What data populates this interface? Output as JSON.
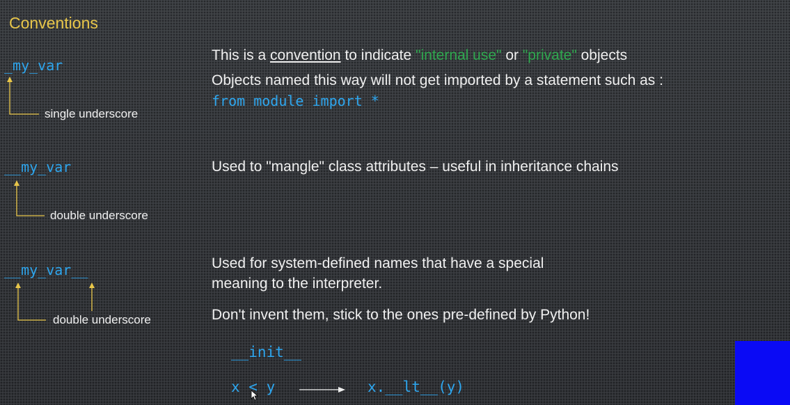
{
  "title": "Conventions",
  "rows": [
    {
      "var": "_my_var",
      "annotation": "single underscore",
      "line1": {
        "pre": "This is a ",
        "convention": "convention",
        "mid1": " to indicate ",
        "internal": "\"internal use\"",
        "mid2": " or ",
        "private": "\"private\"",
        "post": " objects"
      },
      "line2": "Objects named this way will not get imported by a statement such as :",
      "code": "from module import *"
    },
    {
      "var": "__my_var",
      "annotation": "double underscore",
      "line1": "Used to \"mangle\" class attributes – useful in inheritance chains"
    },
    {
      "var": "__my_var__",
      "annotation": "double underscore",
      "line1": "Used for system-defined names that have a special",
      "line2": "meaning to the interpreter.",
      "line3": "Don't invent them, stick to the ones pre-defined by Python!",
      "example1": "__init__",
      "example2_left": "x < y",
      "example2_right": "x.__lt__(y)"
    }
  ],
  "colors": {
    "title": "#e8c64a",
    "code": "#2ea6ee",
    "green": "#2fa84f",
    "arrow": "#e8c64a",
    "blue_square": "#0a0af5"
  },
  "icons": [
    "mouse-cursor-icon",
    "arrow-right-icon"
  ]
}
